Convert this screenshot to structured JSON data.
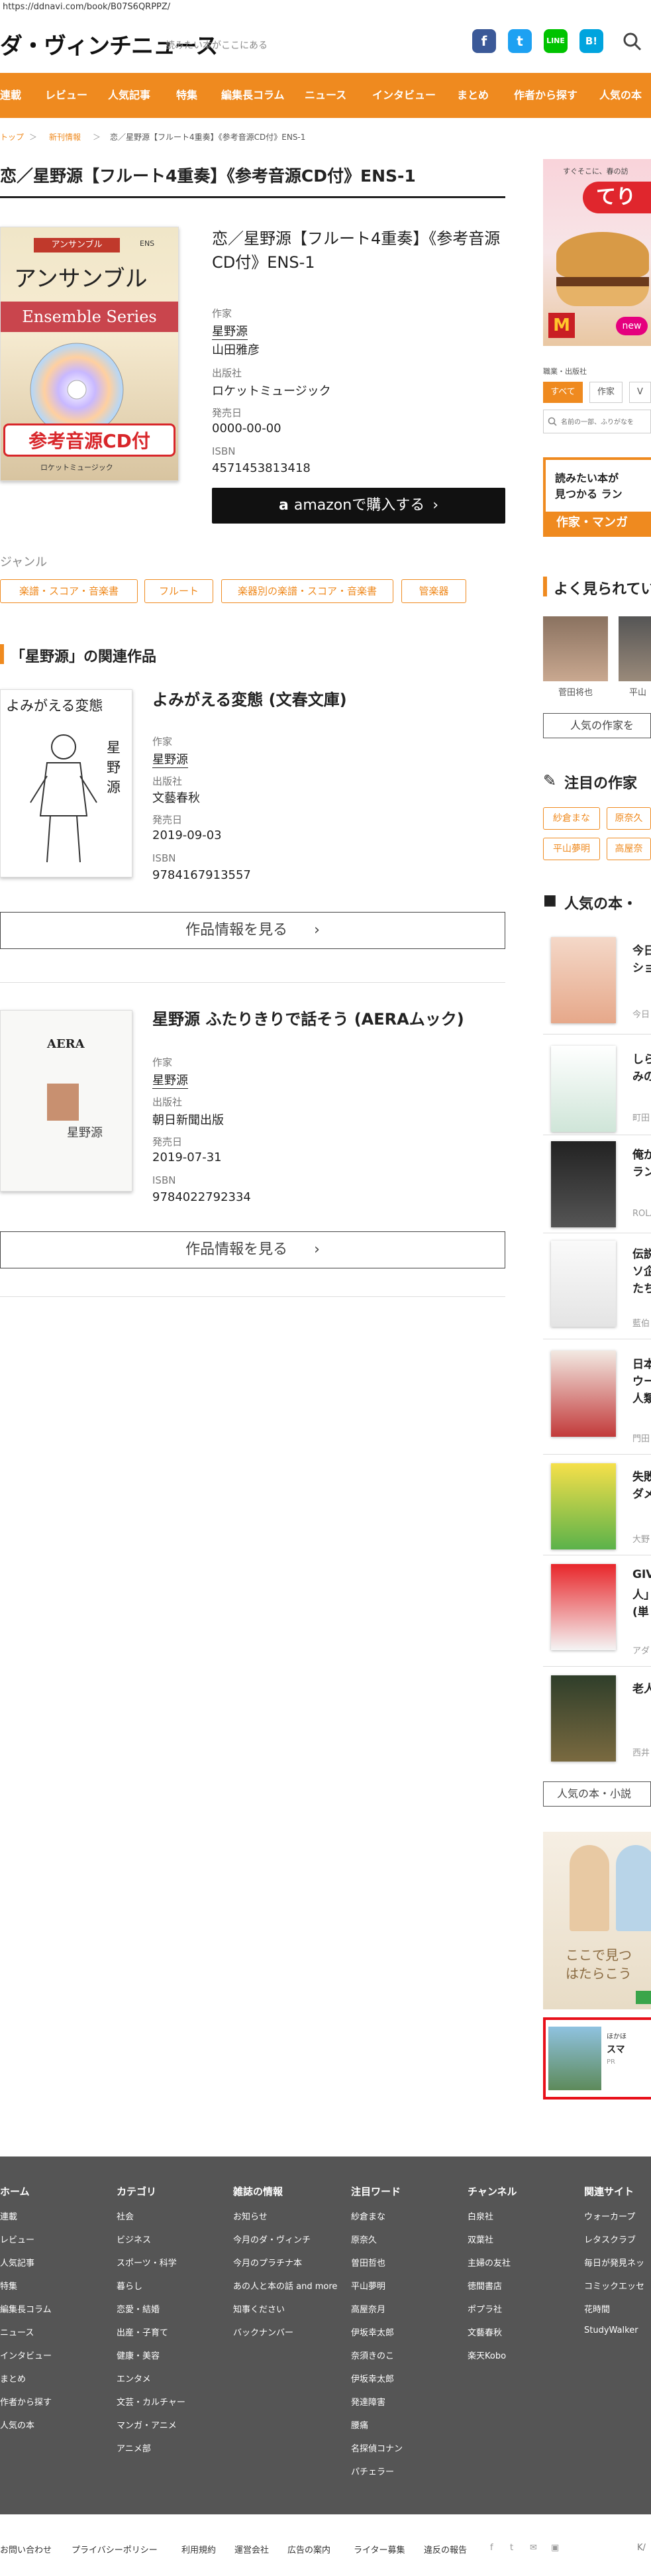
{
  "url": "https://ddnavi.com/book/B07S6QRPPZ/",
  "header": {
    "logo": "ダ・ヴィンチニュース",
    "tagline": "読みたい本がここにある"
  },
  "icons": {
    "facebook": "f",
    "twitter": "t",
    "line": "LINE",
    "hatena": "B!",
    "search": "search-icon"
  },
  "colors": {
    "accent": "#ef8a1f",
    "footer": "#555555",
    "amazon": "#111111"
  },
  "nav": [
    "連載",
    "レビュー",
    "人気記事",
    "特集",
    "編集長コラム",
    "ニュース",
    "インタビュー",
    "まとめ",
    "作者から探す",
    "人気の本"
  ],
  "breadcrumb": {
    "home": "トップ",
    "sep": "＞",
    "category": "新刊情報",
    "current": "恋／星野源【フルート4重奏】《参考音源CD付》ENS-1"
  },
  "title": "恋／星野源【フルート4重奏】《参考音源CD付》ENS-1",
  "book": {
    "title": "恋／星野源【フルート4重奏】《参考音源CD付》ENS-1",
    "cover_top": "アンサンブル",
    "cover_ens": "ENS",
    "cover_main": "アンサンブル",
    "cover_series": "Ensemble Series",
    "cover_band": "参考音源CD付",
    "cover_publisher": "ロケットミュージック",
    "author_label": "作家",
    "author": "星野源",
    "author2": "山田雅彦",
    "publisher_label": "出版社",
    "publisher": "ロケットミュージック",
    "date_label": "発売日",
    "date": "0000-00-00",
    "isbn_label": "ISBN",
    "isbn": "4571453813418",
    "amazon": "amazonで購入する"
  },
  "genre": {
    "label": "ジャンル",
    "tags": [
      "楽譜・スコア・音楽書",
      "フルート",
      "楽器別の楽譜・スコア・音楽書",
      "管楽器"
    ]
  },
  "related": {
    "heading": "「星野源」の関連作品",
    "detail_label": "作品情報を見る",
    "items": [
      {
        "title": "よみがえる変態 (文春文庫)",
        "cover_text": "よみがえる変態",
        "cover_author": "星野源",
        "author_label": "作家",
        "author": "星野源",
        "publisher_label": "出版社",
        "publisher": "文藝春秋",
        "date_label": "発売日",
        "date": "2019-09-03",
        "isbn_label": "ISBN",
        "isbn": "9784167913557"
      },
      {
        "title": "星野源 ふたりきりで話そう (AERAムック)",
        "cover_text": "AERA",
        "cover_author": "星野源",
        "author_label": "作家",
        "author": "星野源",
        "publisher_label": "出版社",
        "publisher": "朝日新聞出版",
        "date_label": "発売日",
        "date": "2019-07-31",
        "isbn_label": "ISBN",
        "isbn": "9784022792334"
      }
    ]
  },
  "sidebar": {
    "ad1_line1": "すぐそこに、春の訪",
    "ad1_line2": "てり",
    "ad1_tag": "new",
    "filter_label": "職業・出版社",
    "tabs": [
      "すべて",
      "作家",
      "V"
    ],
    "search_placeholder": "名前の一部、ふりがなを",
    "banner_line1": "読みたい本が",
    "banner_line2": "見つかる ラン",
    "banner_bottom": "作家・マンガ",
    "popular_heading": "よく見られてい",
    "people": [
      "菅田将也",
      "平山"
    ],
    "popular_button": "人気の作家を",
    "featured_heading": "注目の作家",
    "featured_tags": [
      "紗倉まな",
      "原奈久",
      "平山夢明",
      "高屋奈"
    ],
    "ranking_heading": "人気の本・",
    "ranking": [
      {
        "title": "今日",
        "title2": "ショ",
        "author": "今日"
      },
      {
        "title": "しら",
        "title2": "みの",
        "author": "町田"
      },
      {
        "title": "俺が",
        "title2": "ラン",
        "author": "ROLA"
      },
      {
        "title": "伝説",
        "title2": "ソ企",
        "title3": "たち",
        "author": "藍伯"
      },
      {
        "title": "日本",
        "title2": "ウー",
        "title3": "人類",
        "author": "門田"
      },
      {
        "title": "失敗",
        "title2": "ダメ",
        "author": "大野"
      },
      {
        "title": "GIV",
        "title2": "人」",
        "title3": "(単",
        "author": "アダ"
      },
      {
        "title": "老人",
        "author": "西井"
      }
    ],
    "ranking_more": "人気の本・小説",
    "ad2_text1": "ここで見つ",
    "ad2_text2": "はたらこう",
    "ad3_text1": "ほかほ",
    "ad3_text2": "スマ",
    "ad3_text3": "PR"
  },
  "footer": {
    "cols": [
      {
        "head": "ホーム",
        "items": [
          "連載",
          "レビュー",
          "人気記事",
          "特集",
          "編集長コラム",
          "ニュース",
          "インタビュー",
          "まとめ",
          "作者から探す",
          "人気の本"
        ]
      },
      {
        "head": "カテゴリ",
        "items": [
          "社会",
          "ビジネス",
          "スポーツ・科学",
          "暮らし",
          "恋愛・結婚",
          "出産・子育て",
          "健康・美容",
          "エンタメ",
          "文芸・カルチャー",
          "マンガ・アニメ",
          "アニメ部"
        ]
      },
      {
        "head": "雑誌の情報",
        "items": [
          "お知らせ",
          "今月のダ・ヴィンチ",
          "今月のプラチナ本",
          "あの人と本の話 and more",
          "知事ください",
          "バックナンバー"
        ]
      },
      {
        "head": "注目ワード",
        "items": [
          "紗倉まな",
          "原奈久",
          "曽田哲也",
          "平山夢明",
          "高屋奈月",
          "伊坂幸太郎",
          "奈須きのこ",
          "伊坂幸太郎",
          "発達障害",
          "腰痛",
          "名探偵コナン",
          "パチェラー"
        ]
      },
      {
        "head": "チャンネル",
        "items": [
          "白泉社",
          "双葉社",
          "主婦の友社",
          "徳間書店",
          "ポプラ社",
          "文藝春秋",
          "楽天Kobo"
        ]
      },
      {
        "head": "関連サイト",
        "items": [
          "ウォーカープ",
          "レタスクラブ",
          "毎日が発見ネッ",
          "コミックエッセ",
          "花時間",
          "StudyWalker"
        ]
      }
    ],
    "bottom": [
      "お問い合わせ",
      "プライバシーポリシー",
      "利用規約",
      "運営会社",
      "広告の案内",
      "ライター募集",
      "違反の報告"
    ],
    "bottom_icons": [
      "f",
      "t",
      "✉",
      "▣"
    ],
    "copyright": "K/"
  }
}
